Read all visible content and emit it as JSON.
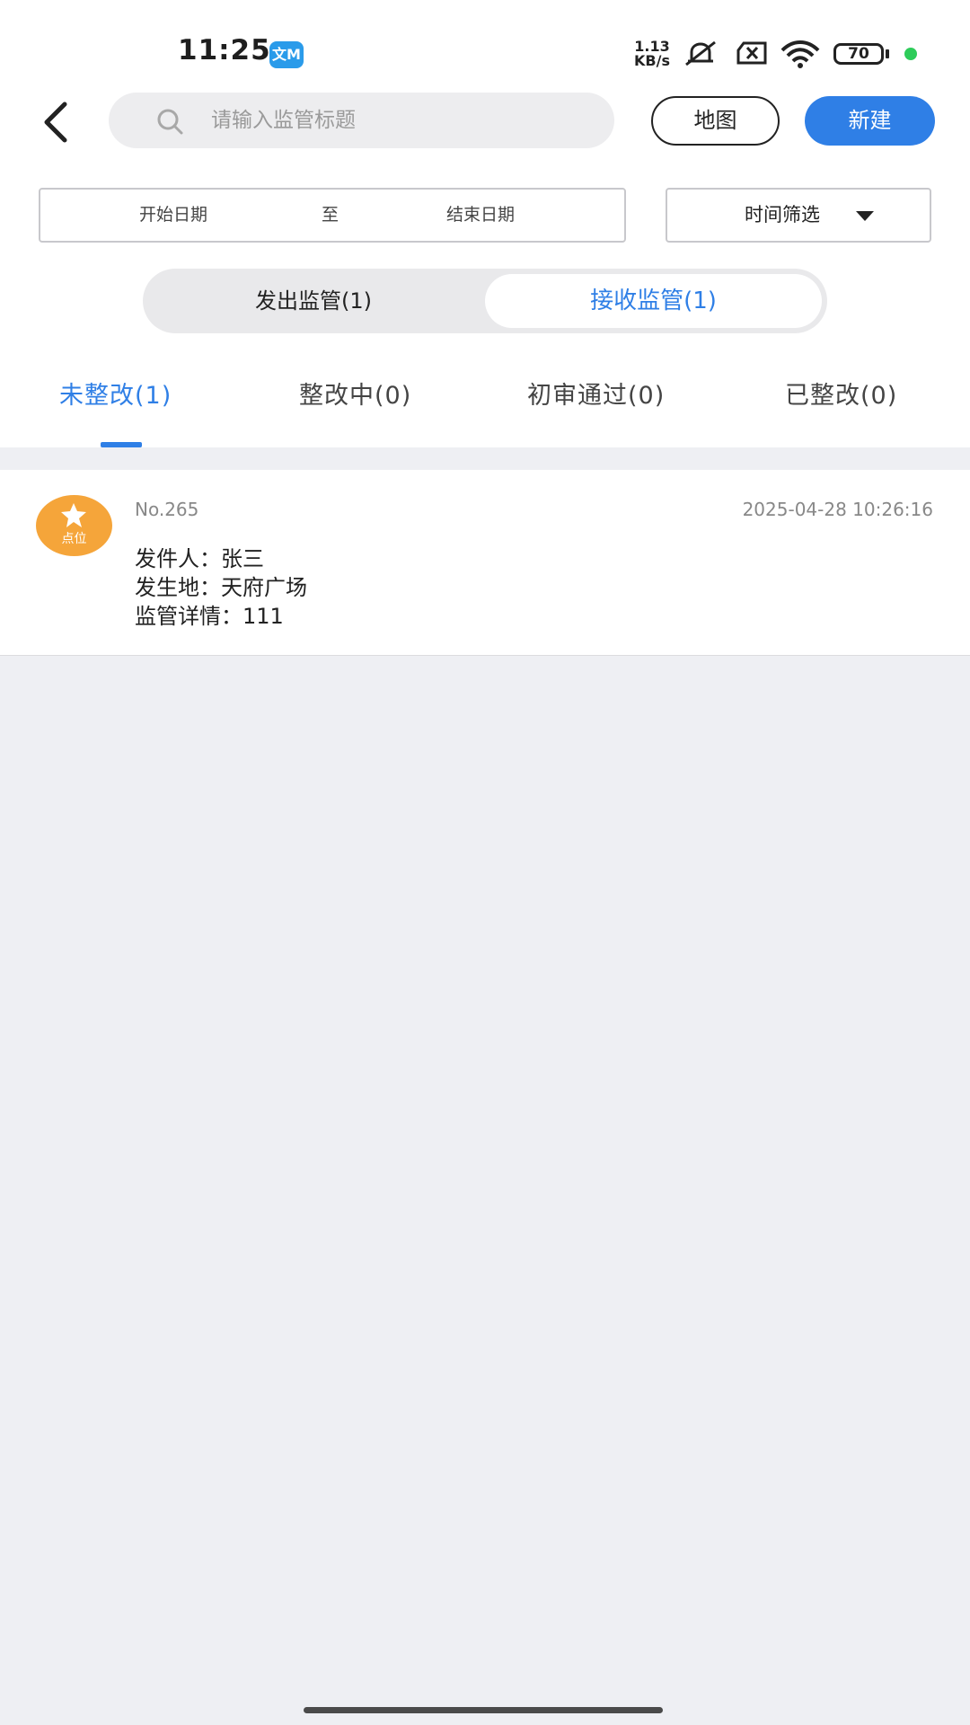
{
  "status_bar": {
    "time": "11:25",
    "app_badge": "文M",
    "net_speed_value": "1.13",
    "net_speed_unit": "KB/s",
    "battery": "70",
    "icons": [
      "mute-icon",
      "no-sim-icon",
      "wifi-icon",
      "battery-icon"
    ]
  },
  "header": {
    "search_placeholder": "请输入监管标题",
    "map_button": "地图",
    "new_button": "新建"
  },
  "filters": {
    "start_date": "开始日期",
    "to": "至",
    "end_date": "结束日期",
    "time_filter": "时间筛选"
  },
  "segment": {
    "options": [
      "发出监管(1)",
      "接收监管(1)"
    ],
    "selected": "接收监管(1)"
  },
  "tabs": {
    "items": [
      "未整改(1)",
      "整改中(0)",
      "初审通过(0)",
      "已整改(0)"
    ],
    "active": "未整改(1)"
  },
  "records": [
    {
      "badge": "点位",
      "no": "No.265",
      "time": "2025-04-28 10:26:16",
      "sender": "发件人：张三",
      "location": "发生地：天府广场",
      "detail": "监管详情：111"
    }
  ],
  "colors": {
    "accent": "#2f7fe6",
    "badge": "#f5a53a",
    "background": "#eeeff3"
  }
}
